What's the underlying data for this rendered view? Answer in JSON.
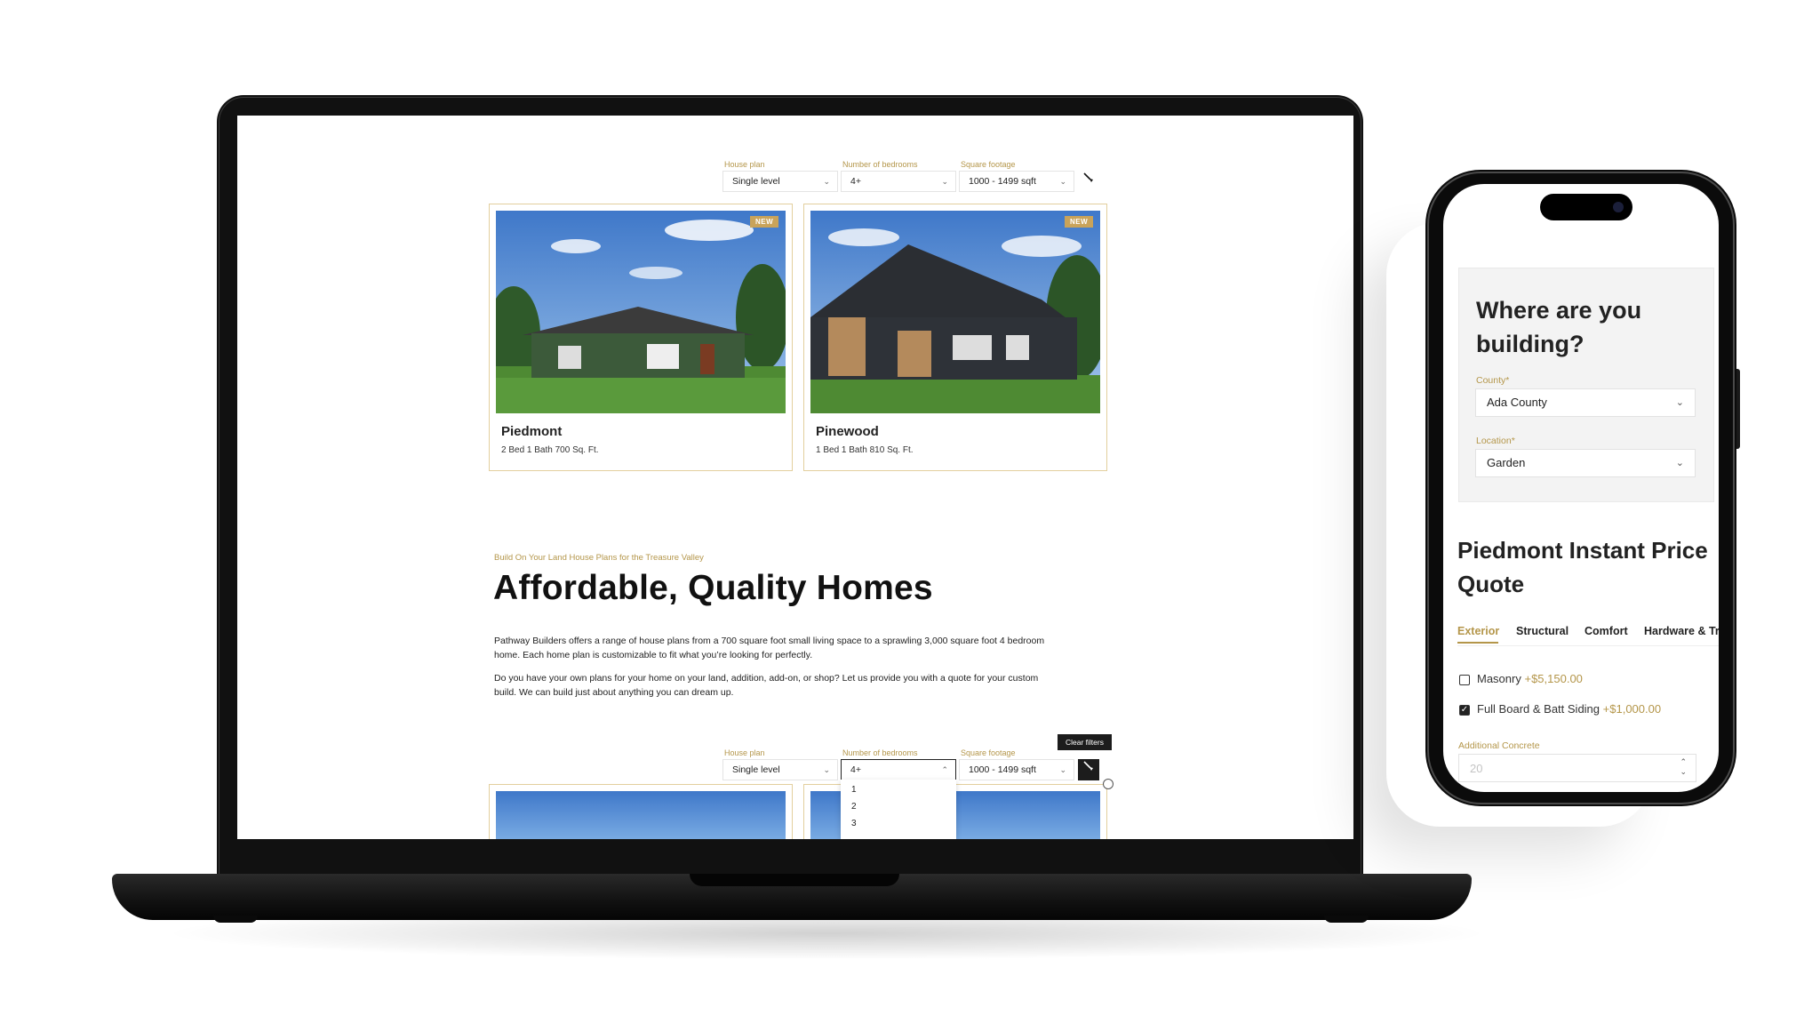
{
  "laptop_site": {
    "filters_top": {
      "house_plan_label": "House plan",
      "house_plan_value": "Single level",
      "bedrooms_label": "Number of bedrooms",
      "bedrooms_value": "4+",
      "sqft_label": "Square footage",
      "sqft_value": "1000 - 1499 sqft"
    },
    "cards_top": [
      {
        "badge": "NEW",
        "title": "Piedmont",
        "subtitle": "2 Bed 1 Bath 700 Sq. Ft."
      },
      {
        "badge": "NEW",
        "title": "Pinewood",
        "subtitle": "1 Bed 1 Bath 810 Sq. Ft."
      }
    ],
    "section": {
      "eyebrow": "Build On Your Land House Plans for the Treasure Valley",
      "heading": "Affordable, Quality Homes",
      "para1": "Pathway Builders offers a range of house plans from a 700 square foot small living space to a sprawling 3,000 square foot 4 bedroom home. Each home plan is customizable to fit what you’re looking for perfectly.",
      "para2": "Do you have your own plans for your home on your land, addition, add-on, or shop? Let us provide you with a quote for your custom build. We can build just about anything you can dream up."
    },
    "filters_bottom": {
      "house_plan_label": "House plan",
      "house_plan_value": "Single level",
      "bedrooms_label": "Number of bedrooms",
      "bedrooms_value": "4+",
      "sqft_label": "Square footage",
      "sqft_value": "1000 - 1499 sqft",
      "tooltip": "Clear filters",
      "bedroom_options": [
        "1",
        "2",
        "3"
      ]
    }
  },
  "phone_site": {
    "location_heading": "Where are you building?",
    "county_label": "County*",
    "county_value": "Ada County",
    "location_label": "Location*",
    "location_value": "Garden",
    "quote_heading": "Piedmont Instant Price Quote",
    "tabs": [
      "Exterior",
      "Structural",
      "Comfort",
      "Hardware & Trim"
    ],
    "options": [
      {
        "label": "Masonry",
        "price": "+$5,150.00",
        "checked": false
      },
      {
        "label": "Full Board & Batt Siding",
        "price": "+$1,000.00",
        "checked": true
      }
    ],
    "concrete_label": "Additional Concrete",
    "concrete_placeholder": "20"
  },
  "colors": {
    "accent_gold": "#b4964a",
    "card_border": "#e3cf9d",
    "text_dark": "#222222"
  }
}
